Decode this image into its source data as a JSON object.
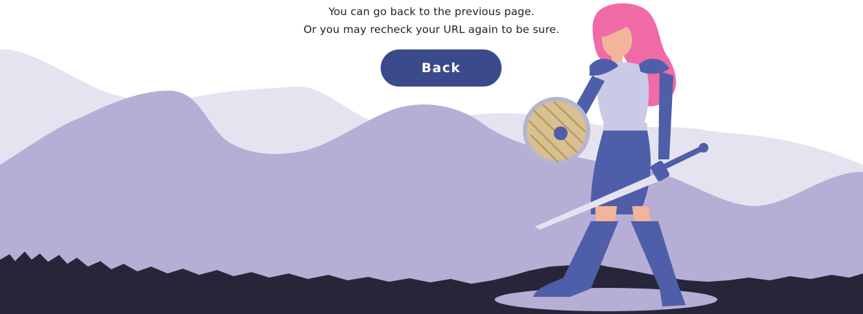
{
  "message": {
    "line1": "You can go back to the previous page.",
    "line2": "Or you may recheck your URL again to be sure."
  },
  "actions": {
    "back_label": "Back"
  },
  "colors": {
    "button": "#3b4a8a",
    "mountain_far": "#e6e3f0",
    "mountain_near": "#b6aed5",
    "grass": "#262638",
    "warrior_armor": "#4f5ea8",
    "warrior_hair": "#f06aa8"
  },
  "illustration": {
    "subject": "warrior-woman-with-sword-and-shield",
    "icons": [
      "mountain-icon",
      "sword-icon",
      "shield-icon"
    ]
  }
}
